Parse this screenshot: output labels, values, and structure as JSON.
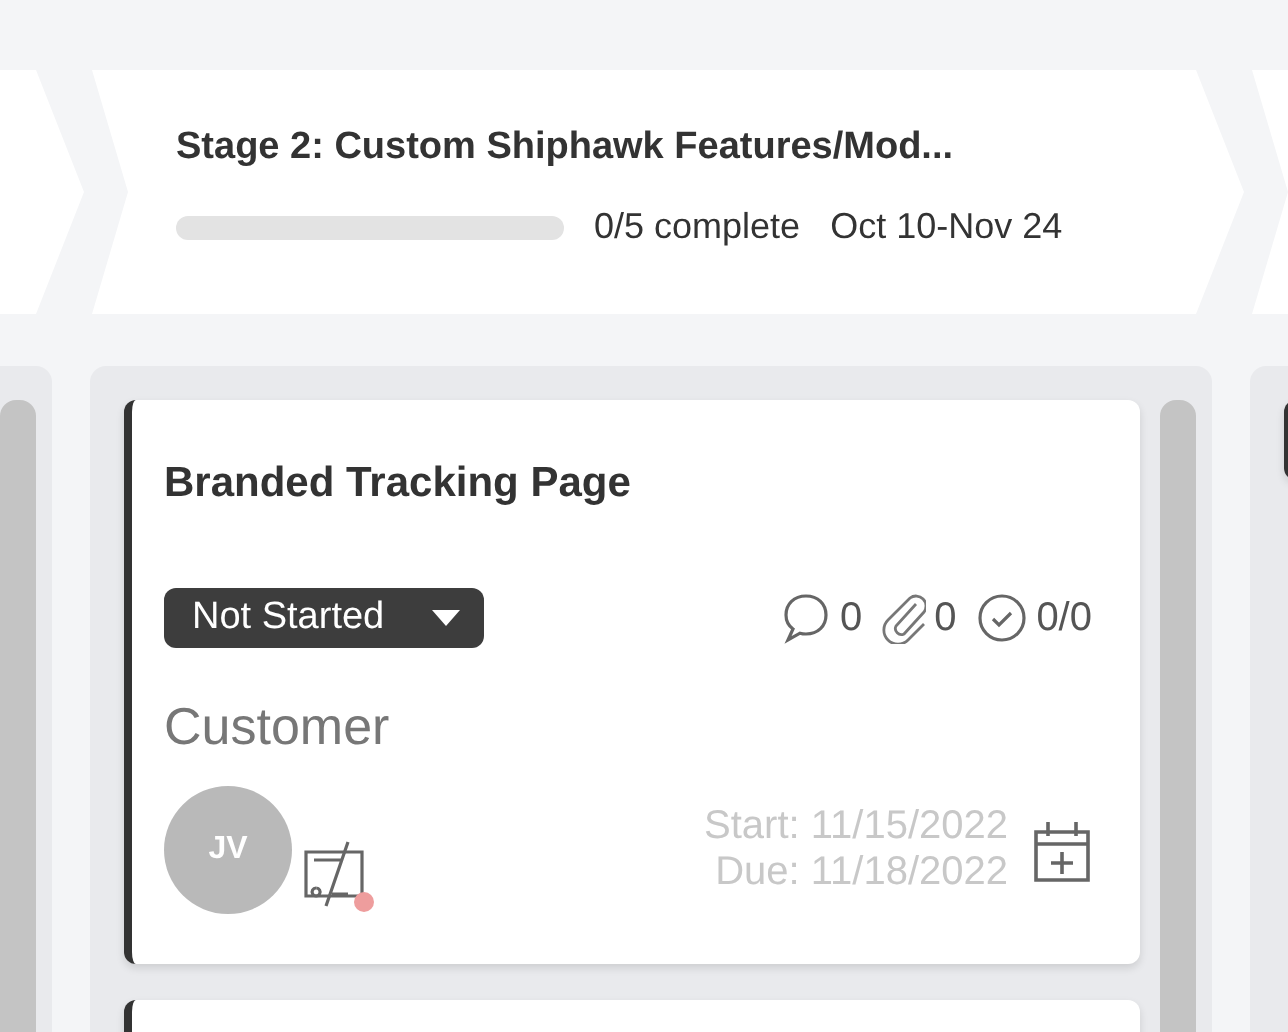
{
  "stages": [
    {
      "kind": "leading"
    },
    {
      "kind": "full",
      "title": "Stage 2: Custom Shiphawk Features/Mod...",
      "level": 0,
      "progress_text": "0/5 complete",
      "dates": "Oct 10-Nov 24"
    },
    {
      "kind": "trailing"
    }
  ],
  "columns": [
    {},
    {
      "cards": [
        {
          "kind": "full",
          "title": "Branded Tracking Page",
          "status": "Not Started",
          "comments": "0",
          "attachments": "0",
          "checklist": "0/0",
          "group": "Customer",
          "assignee": "JV",
          "alert": true,
          "start": "Start: 11/15/2022",
          "due": "Due: 11/18/2022"
        },
        {
          "kind": "partial"
        }
      ]
    },
    {
      "cards": [
        {
          "kind": "partial"
        }
      ]
    }
  ]
}
